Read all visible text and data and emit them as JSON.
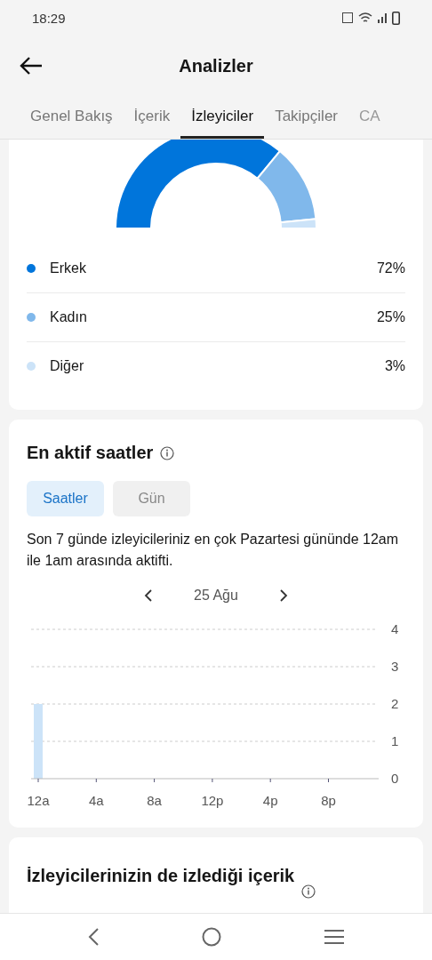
{
  "status_bar": {
    "time": "18:29"
  },
  "header": {
    "title": "Analizler"
  },
  "tabs": [
    {
      "label": "Genel Bakış",
      "selected": false
    },
    {
      "label": "İçerik",
      "selected": false
    },
    {
      "label": "İzleyiciler",
      "selected": true
    },
    {
      "label": "Takipçiler",
      "selected": false
    },
    {
      "label": "CA",
      "selected": false
    }
  ],
  "gender": {
    "chart_data": {
      "type": "donut",
      "categories": [
        "Erkek",
        "Kadın",
        "Diğer"
      ],
      "values": [
        72,
        25,
        3
      ]
    },
    "legend": [
      {
        "value": "72%",
        "color": "#0075db"
      },
      {
        "value": "25%",
        "color": "#80b8eb"
      },
      {
        "value": "3%",
        "color": "#cce3f8"
      }
    ]
  },
  "active_hours": {
    "title": "En aktif saatler",
    "toggles": [
      {
        "label": "Saatler",
        "selected": true
      },
      {
        "label": "Gün",
        "selected": false
      }
    ],
    "summary": "Son 7 günde izleyicileriniz en çok Pazartesi gününde 12am ile 1am arasında aktifti.",
    "date": "25 Ağu",
    "chart_data": {
      "type": "bar",
      "categories": [
        "12a",
        "4a",
        "8a",
        "12p",
        "4p",
        "8p"
      ],
      "values": [
        2,
        0,
        0,
        0,
        0,
        0
      ],
      "ylim": [
        0,
        4
      ],
      "yticks": [
        0,
        1,
        2,
        3,
        4
      ],
      "grid": true
    }
  },
  "related": {
    "title": "İzleyicilerinizin de izlediği içerik"
  }
}
